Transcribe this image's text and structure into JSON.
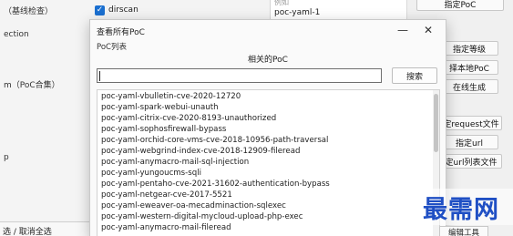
{
  "background": {
    "left_labels": [
      "（基线检查）",
      "ection",
      "m（PoC合集）",
      "p"
    ],
    "select_all": "选 / 取消全选",
    "dirscan_label": "dirscan",
    "top_right_faint": "例如",
    "top_right_value": "poc-yaml-1",
    "right_buttons": [
      "指定PoC",
      "指定等级",
      "择本地PoC",
      "在线生成",
      "定request文件",
      "指定url",
      "定url列表文件",
      "编辑工具"
    ]
  },
  "dialog": {
    "title": "查看所有PoC",
    "minimize_glyph": "—",
    "close_glyph": "✕",
    "group_label": "PoC列表",
    "section_title": "相关的PoC",
    "search_value": "",
    "search_button": "搜索",
    "items": [
      "poc-yaml-vbulletin-cve-2020-12720",
      "poc-yaml-spark-webui-unauth",
      "poc-yaml-citrix-cve-2020-8193-unauthorized",
      "poc-yaml-sophosfirewall-bypass",
      "poc-yaml-orchid-core-vms-cve-2018-10956-path-traversal",
      "poc-yaml-webgrind-index-cve-2018-12909-fileread",
      "poc-yaml-anymacro-mail-sql-injection",
      "poc-yaml-yungoucms-sqli",
      "poc-yaml-pentaho-cve-2021-31602-authentication-bypass",
      "poc-yaml-netgear-cve-2017-5521",
      "poc-yaml-eweaver-oa-mecadminaction-sqlexec",
      "poc-yaml-western-digital-mycloud-upload-php-exec",
      "poc-yaml-anymacro-mail-fileread"
    ]
  },
  "watermark": "最需网",
  "colors": {
    "checkbox": "#1a6fd0",
    "watermark": "#1f4fc4"
  }
}
